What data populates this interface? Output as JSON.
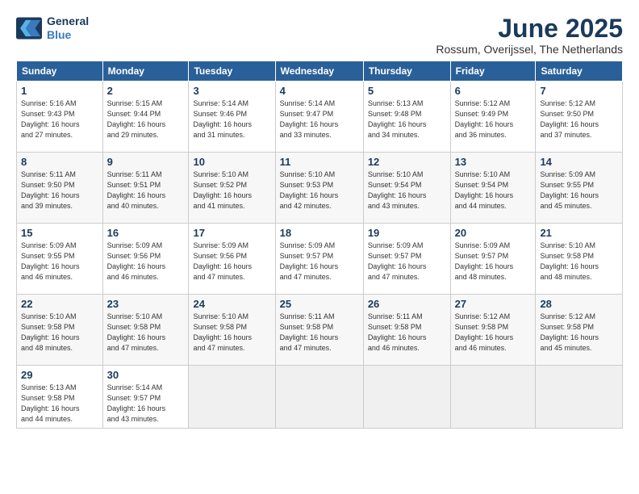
{
  "logo": {
    "line1": "General",
    "line2": "Blue"
  },
  "title": "June 2025",
  "subtitle": "Rossum, Overijssel, The Netherlands",
  "weekdays": [
    "Sunday",
    "Monday",
    "Tuesday",
    "Wednesday",
    "Thursday",
    "Friday",
    "Saturday"
  ],
  "weeks": [
    [
      {
        "day": 1,
        "rise": "5:16 AM",
        "set": "9:43 PM",
        "daylight": "16 hours and 27 minutes."
      },
      {
        "day": 2,
        "rise": "5:15 AM",
        "set": "9:44 PM",
        "daylight": "16 hours and 29 minutes."
      },
      {
        "day": 3,
        "rise": "5:14 AM",
        "set": "9:46 PM",
        "daylight": "16 hours and 31 minutes."
      },
      {
        "day": 4,
        "rise": "5:14 AM",
        "set": "9:47 PM",
        "daylight": "16 hours and 33 minutes."
      },
      {
        "day": 5,
        "rise": "5:13 AM",
        "set": "9:48 PM",
        "daylight": "16 hours and 34 minutes."
      },
      {
        "day": 6,
        "rise": "5:12 AM",
        "set": "9:49 PM",
        "daylight": "16 hours and 36 minutes."
      },
      {
        "day": 7,
        "rise": "5:12 AM",
        "set": "9:50 PM",
        "daylight": "16 hours and 37 minutes."
      }
    ],
    [
      {
        "day": 8,
        "rise": "5:11 AM",
        "set": "9:50 PM",
        "daylight": "16 hours and 39 minutes."
      },
      {
        "day": 9,
        "rise": "5:11 AM",
        "set": "9:51 PM",
        "daylight": "16 hours and 40 minutes."
      },
      {
        "day": 10,
        "rise": "5:10 AM",
        "set": "9:52 PM",
        "daylight": "16 hours and 41 minutes."
      },
      {
        "day": 11,
        "rise": "5:10 AM",
        "set": "9:53 PM",
        "daylight": "16 hours and 42 minutes."
      },
      {
        "day": 12,
        "rise": "5:10 AM",
        "set": "9:54 PM",
        "daylight": "16 hours and 43 minutes."
      },
      {
        "day": 13,
        "rise": "5:10 AM",
        "set": "9:54 PM",
        "daylight": "16 hours and 44 minutes."
      },
      {
        "day": 14,
        "rise": "5:09 AM",
        "set": "9:55 PM",
        "daylight": "16 hours and 45 minutes."
      }
    ],
    [
      {
        "day": 15,
        "rise": "5:09 AM",
        "set": "9:55 PM",
        "daylight": "16 hours and 46 minutes."
      },
      {
        "day": 16,
        "rise": "5:09 AM",
        "set": "9:56 PM",
        "daylight": "16 hours and 46 minutes."
      },
      {
        "day": 17,
        "rise": "5:09 AM",
        "set": "9:56 PM",
        "daylight": "16 hours and 47 minutes."
      },
      {
        "day": 18,
        "rise": "5:09 AM",
        "set": "9:57 PM",
        "daylight": "16 hours and 47 minutes."
      },
      {
        "day": 19,
        "rise": "5:09 AM",
        "set": "9:57 PM",
        "daylight": "16 hours and 47 minutes."
      },
      {
        "day": 20,
        "rise": "5:09 AM",
        "set": "9:57 PM",
        "daylight": "16 hours and 48 minutes."
      },
      {
        "day": 21,
        "rise": "5:10 AM",
        "set": "9:58 PM",
        "daylight": "16 hours and 48 minutes."
      }
    ],
    [
      {
        "day": 22,
        "rise": "5:10 AM",
        "set": "9:58 PM",
        "daylight": "16 hours and 48 minutes."
      },
      {
        "day": 23,
        "rise": "5:10 AM",
        "set": "9:58 PM",
        "daylight": "16 hours and 47 minutes."
      },
      {
        "day": 24,
        "rise": "5:10 AM",
        "set": "9:58 PM",
        "daylight": "16 hours and 47 minutes."
      },
      {
        "day": 25,
        "rise": "5:11 AM",
        "set": "9:58 PM",
        "daylight": "16 hours and 47 minutes."
      },
      {
        "day": 26,
        "rise": "5:11 AM",
        "set": "9:58 PM",
        "daylight": "16 hours and 46 minutes."
      },
      {
        "day": 27,
        "rise": "5:12 AM",
        "set": "9:58 PM",
        "daylight": "16 hours and 46 minutes."
      },
      {
        "day": 28,
        "rise": "5:12 AM",
        "set": "9:58 PM",
        "daylight": "16 hours and 45 minutes."
      }
    ],
    [
      {
        "day": 29,
        "rise": "5:13 AM",
        "set": "9:58 PM",
        "daylight": "16 hours and 44 minutes."
      },
      {
        "day": 30,
        "rise": "5:14 AM",
        "set": "9:57 PM",
        "daylight": "16 hours and 43 minutes."
      },
      null,
      null,
      null,
      null,
      null
    ]
  ]
}
